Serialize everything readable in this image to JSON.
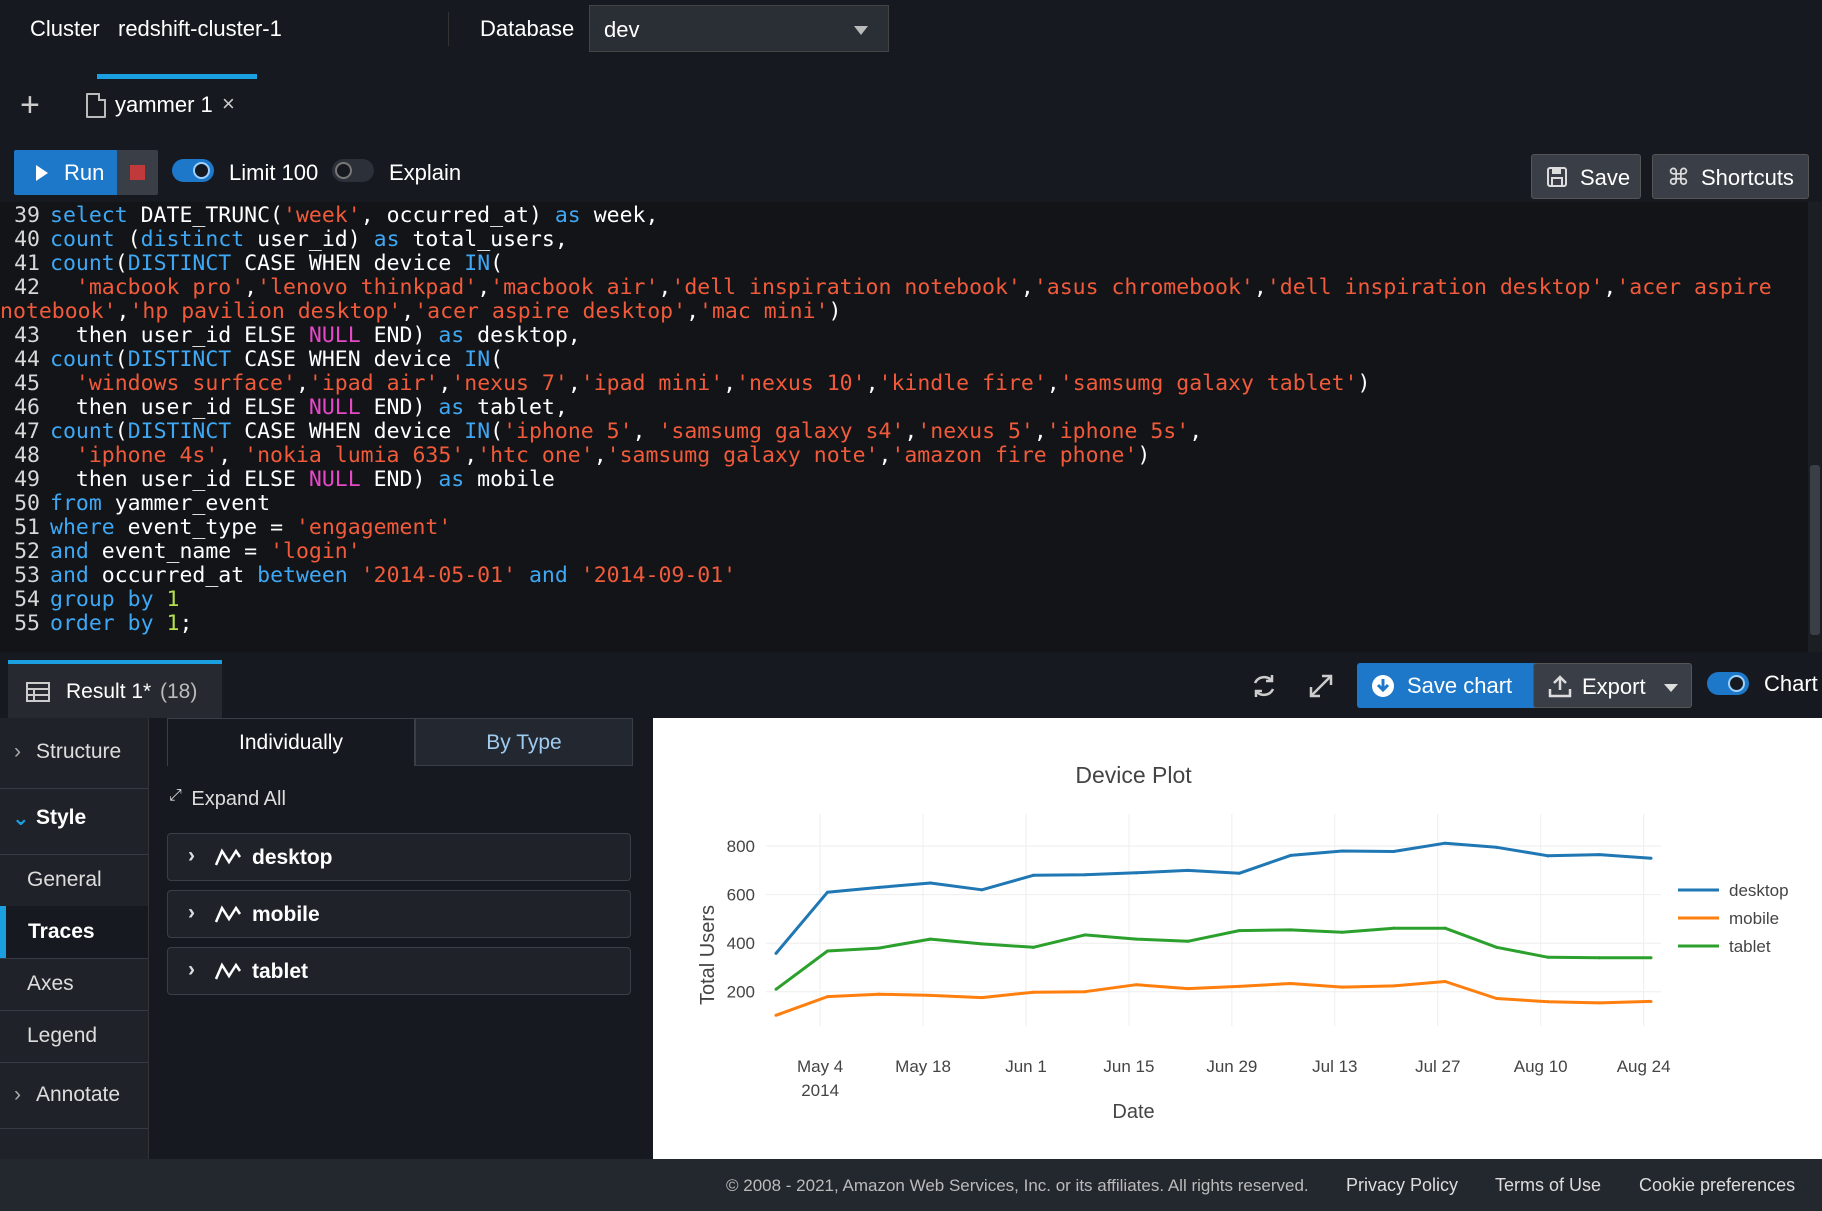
{
  "header": {
    "cluster_label": "Cluster",
    "cluster_value": "redshift-cluster-1",
    "database_label": "Database",
    "database_value": "dev"
  },
  "tabs": [
    {
      "title": "yammer 1",
      "close": "×"
    }
  ],
  "toolbar": {
    "run": "Run",
    "limit_label": "Limit 100",
    "limit_on": true,
    "explain_label": "Explain",
    "explain_on": false,
    "save": "Save",
    "shortcuts": "Shortcuts"
  },
  "editor": {
    "lines": [
      {
        "n": "39",
        "tokens": [
          [
            "kw",
            "select"
          ],
          [
            "t",
            " DATE_TRUNC("
          ],
          [
            "str",
            "'week'"
          ],
          [
            "t",
            ", occurred_at) "
          ],
          [
            "kw",
            "as"
          ],
          [
            "t",
            " week,"
          ]
        ]
      },
      {
        "n": "40",
        "tokens": [
          [
            "kw",
            "count"
          ],
          [
            "t",
            " ("
          ],
          [
            "kw",
            "distinct"
          ],
          [
            "t",
            " user_id) "
          ],
          [
            "kw",
            "as"
          ],
          [
            "t",
            " total_users,"
          ]
        ]
      },
      {
        "n": "41",
        "tokens": [
          [
            "kw",
            "count"
          ],
          [
            "t",
            "("
          ],
          [
            "kw",
            "DISTINCT"
          ],
          [
            "t",
            " CASE WHEN device "
          ],
          [
            "kw",
            "IN"
          ],
          [
            "t",
            "("
          ]
        ]
      },
      {
        "n": "42",
        "tokens": [
          [
            "t",
            "  "
          ],
          [
            "str",
            "'macbook pro'"
          ],
          [
            "t",
            ","
          ],
          [
            "str",
            "'lenovo thinkpad'"
          ],
          [
            "t",
            ","
          ],
          [
            "str",
            "'macbook air'"
          ],
          [
            "t",
            ","
          ],
          [
            "str",
            "'dell inspiration notebook'"
          ],
          [
            "t",
            ","
          ],
          [
            "str",
            "'asus chromebook'"
          ],
          [
            "t",
            ","
          ],
          [
            "str",
            "'dell inspiration desktop'"
          ],
          [
            "t",
            ","
          ],
          [
            "str",
            "'acer aspire"
          ]
        ]
      },
      {
        "n": "",
        "tokens": [
          [
            "str",
            "notebook'"
          ],
          [
            "t",
            ","
          ],
          [
            "str",
            "'hp pavilion desktop'"
          ],
          [
            "t",
            ","
          ],
          [
            "str",
            "'acer aspire desktop'"
          ],
          [
            "t",
            ","
          ],
          [
            "str",
            "'mac mini'"
          ],
          [
            "t",
            ")"
          ]
        ]
      },
      {
        "n": "43",
        "tokens": [
          [
            "t",
            "  then user_id ELSE "
          ],
          [
            "nul",
            "NULL"
          ],
          [
            "t",
            " END) "
          ],
          [
            "kw",
            "as"
          ],
          [
            "t",
            " desktop,"
          ]
        ]
      },
      {
        "n": "44",
        "tokens": [
          [
            "kw",
            "count"
          ],
          [
            "t",
            "("
          ],
          [
            "kw",
            "DISTINCT"
          ],
          [
            "t",
            " CASE WHEN device "
          ],
          [
            "kw",
            "IN"
          ],
          [
            "t",
            "("
          ]
        ]
      },
      {
        "n": "45",
        "tokens": [
          [
            "t",
            "  "
          ],
          [
            "str",
            "'windows surface'"
          ],
          [
            "t",
            ","
          ],
          [
            "str",
            "'ipad air'"
          ],
          [
            "t",
            ","
          ],
          [
            "str",
            "'nexus 7'"
          ],
          [
            "t",
            ","
          ],
          [
            "str",
            "'ipad mini'"
          ],
          [
            "t",
            ","
          ],
          [
            "str",
            "'nexus 10'"
          ],
          [
            "t",
            ","
          ],
          [
            "str",
            "'kindle fire'"
          ],
          [
            "t",
            ","
          ],
          [
            "str",
            "'samsumg galaxy tablet'"
          ],
          [
            "t",
            ")"
          ]
        ]
      },
      {
        "n": "46",
        "tokens": [
          [
            "t",
            "  then user_id ELSE "
          ],
          [
            "nul",
            "NULL"
          ],
          [
            "t",
            " END) "
          ],
          [
            "kw",
            "as"
          ],
          [
            "t",
            " tablet,"
          ]
        ]
      },
      {
        "n": "47",
        "tokens": [
          [
            "kw",
            "count"
          ],
          [
            "t",
            "("
          ],
          [
            "kw",
            "DISTINCT"
          ],
          [
            "t",
            " CASE WHEN device "
          ],
          [
            "kw",
            "IN"
          ],
          [
            "t",
            "("
          ],
          [
            "str",
            "'iphone 5'"
          ],
          [
            "t",
            ", "
          ],
          [
            "str",
            "'samsumg galaxy s4'"
          ],
          [
            "t",
            ","
          ],
          [
            "str",
            "'nexus 5'"
          ],
          [
            "t",
            ","
          ],
          [
            "str",
            "'iphone 5s'"
          ],
          [
            "t",
            ","
          ]
        ]
      },
      {
        "n": "48",
        "tokens": [
          [
            "t",
            "  "
          ],
          [
            "str",
            "'iphone 4s'"
          ],
          [
            "t",
            ", "
          ],
          [
            "str",
            "'nokia lumia 635'"
          ],
          [
            "t",
            ","
          ],
          [
            "str",
            "'htc one'"
          ],
          [
            "t",
            ","
          ],
          [
            "str",
            "'samsumg galaxy note'"
          ],
          [
            "t",
            ","
          ],
          [
            "str",
            "'amazon fire phone'"
          ],
          [
            "t",
            ")"
          ]
        ]
      },
      {
        "n": "49",
        "tokens": [
          [
            "t",
            "  then user_id ELSE "
          ],
          [
            "nul",
            "NULL"
          ],
          [
            "t",
            " END) "
          ],
          [
            "kw",
            "as"
          ],
          [
            "t",
            " mobile"
          ]
        ]
      },
      {
        "n": "50",
        "tokens": [
          [
            "kw",
            "from"
          ],
          [
            "t",
            " yammer_event"
          ]
        ]
      },
      {
        "n": "51",
        "tokens": [
          [
            "kw",
            "where"
          ],
          [
            "t",
            " event_type = "
          ],
          [
            "str",
            "'engagement'"
          ]
        ]
      },
      {
        "n": "52",
        "tokens": [
          [
            "kw",
            "and"
          ],
          [
            "t",
            " event_name = "
          ],
          [
            "str",
            "'login'"
          ]
        ]
      },
      {
        "n": "53",
        "tokens": [
          [
            "kw",
            "and"
          ],
          [
            "t",
            " occurred_at "
          ],
          [
            "kw",
            "between"
          ],
          [
            "t",
            " "
          ],
          [
            "str",
            "'2014-05-01'"
          ],
          [
            "t",
            " "
          ],
          [
            "kw",
            "and"
          ],
          [
            "t",
            " "
          ],
          [
            "str",
            "'2014-09-01'"
          ]
        ]
      },
      {
        "n": "54",
        "tokens": [
          [
            "kw",
            "group by"
          ],
          [
            "t",
            " "
          ],
          [
            "num",
            "1"
          ]
        ]
      },
      {
        "n": "55",
        "tokens": [
          [
            "kw",
            "order by"
          ],
          [
            "t",
            " "
          ],
          [
            "num",
            "1"
          ],
          [
            "t",
            ";"
          ]
        ]
      }
    ]
  },
  "results": {
    "tab_label": "Result 1*",
    "row_count": "(18)",
    "save_chart": "Save chart",
    "export": "Export",
    "chart_toggle_label": "Chart",
    "chart_on": true
  },
  "leftnav": {
    "structure": "Structure",
    "style": "Style",
    "general": "General",
    "traces": "Traces",
    "axes": "Axes",
    "legend": "Legend",
    "annotate": "Annotate"
  },
  "style_panel": {
    "seg_individually": "Individually",
    "seg_by_type": "By Type",
    "expand_all": "Expand All",
    "traces": [
      "desktop",
      "mobile",
      "tablet"
    ]
  },
  "chart_data": {
    "type": "line",
    "title": "Device Plot",
    "xlabel": "Date",
    "ylabel": "Total Users",
    "x": [
      "2014-04-28",
      "2014-05-05",
      "2014-05-12",
      "2014-05-19",
      "2014-05-26",
      "2014-06-02",
      "2014-06-09",
      "2014-06-16",
      "2014-06-23",
      "2014-06-30",
      "2014-07-07",
      "2014-07-14",
      "2014-07-21",
      "2014-07-28",
      "2014-08-04",
      "2014-08-11",
      "2014-08-18",
      "2014-08-25"
    ],
    "xticks": [
      "May 4\n2014",
      "May 18",
      "Jun 1",
      "Jun 15",
      "Jun 29",
      "Jul 13",
      "Jul 27",
      "Aug 10",
      "Aug 24"
    ],
    "xtick_dates": [
      "2014-05-04",
      "2014-05-18",
      "2014-06-01",
      "2014-06-15",
      "2014-06-29",
      "2014-07-13",
      "2014-07-27",
      "2014-08-10",
      "2014-08-24"
    ],
    "yticks": [
      200,
      400,
      600,
      800
    ],
    "ylim": [
      100,
      850
    ],
    "grid": true,
    "legend_position": "right",
    "series": [
      {
        "name": "desktop",
        "color": "#1f77b4",
        "values": [
          358,
          610,
          630,
          648,
          620,
          680,
          682,
          690,
          700,
          688,
          762,
          780,
          778,
          812,
          795,
          760,
          765,
          750
        ]
      },
      {
        "name": "mobile",
        "color": "#ff7f0e",
        "values": [
          103,
          180,
          190,
          185,
          176,
          198,
          200,
          229,
          213,
          222,
          234,
          219,
          224,
          242,
          172,
          159,
          154,
          160
        ]
      },
      {
        "name": "tablet",
        "color": "#2ca02c",
        "values": [
          210,
          368,
          380,
          417,
          397,
          383,
          434,
          417,
          408,
          452,
          455,
          445,
          462,
          462,
          383,
          342,
          340,
          340
        ]
      }
    ]
  },
  "footer": {
    "copyright": "© 2008 - 2021, Amazon Web Services, Inc. or its affiliates. All rights reserved.",
    "privacy": "Privacy Policy",
    "terms": "Terms of Use",
    "cookies": "Cookie preferences"
  }
}
